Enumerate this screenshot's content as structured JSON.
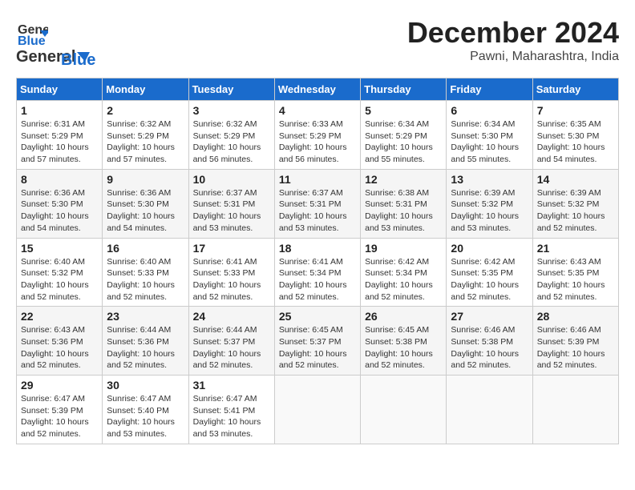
{
  "header": {
    "logo_general": "General",
    "logo_blue": "Blue",
    "main_title": "December 2024",
    "subtitle": "Pawni, Maharashtra, India"
  },
  "calendar": {
    "headers": [
      "Sunday",
      "Monday",
      "Tuesday",
      "Wednesday",
      "Thursday",
      "Friday",
      "Saturday"
    ],
    "weeks": [
      [
        {
          "day": "",
          "info": ""
        },
        {
          "day": "2",
          "info": "Sunrise: 6:32 AM\nSunset: 5:29 PM\nDaylight: 10 hours\nand 57 minutes."
        },
        {
          "day": "3",
          "info": "Sunrise: 6:32 AM\nSunset: 5:29 PM\nDaylight: 10 hours\nand 56 minutes."
        },
        {
          "day": "4",
          "info": "Sunrise: 6:33 AM\nSunset: 5:29 PM\nDaylight: 10 hours\nand 56 minutes."
        },
        {
          "day": "5",
          "info": "Sunrise: 6:34 AM\nSunset: 5:29 PM\nDaylight: 10 hours\nand 55 minutes."
        },
        {
          "day": "6",
          "info": "Sunrise: 6:34 AM\nSunset: 5:30 PM\nDaylight: 10 hours\nand 55 minutes."
        },
        {
          "day": "7",
          "info": "Sunrise: 6:35 AM\nSunset: 5:30 PM\nDaylight: 10 hours\nand 54 minutes."
        }
      ],
      [
        {
          "day": "1",
          "info": "Sunrise: 6:31 AM\nSunset: 5:29 PM\nDaylight: 10 hours\nand 57 minutes."
        },
        {
          "day": "8",
          "info": "Sunrise: 6:36 AM\nSunset: 5:30 PM\nDaylight: 10 hours\nand 54 minutes."
        },
        {
          "day": "9",
          "info": "Sunrise: 6:36 AM\nSunset: 5:30 PM\nDaylight: 10 hours\nand 54 minutes."
        },
        {
          "day": "10",
          "info": "Sunrise: 6:37 AM\nSunset: 5:31 PM\nDaylight: 10 hours\nand 53 minutes."
        },
        {
          "day": "11",
          "info": "Sunrise: 6:37 AM\nSunset: 5:31 PM\nDaylight: 10 hours\nand 53 minutes."
        },
        {
          "day": "12",
          "info": "Sunrise: 6:38 AM\nSunset: 5:31 PM\nDaylight: 10 hours\nand 53 minutes."
        },
        {
          "day": "13",
          "info": "Sunrise: 6:39 AM\nSunset: 5:32 PM\nDaylight: 10 hours\nand 53 minutes."
        },
        {
          "day": "14",
          "info": "Sunrise: 6:39 AM\nSunset: 5:32 PM\nDaylight: 10 hours\nand 52 minutes."
        }
      ],
      [
        {
          "day": "15",
          "info": "Sunrise: 6:40 AM\nSunset: 5:32 PM\nDaylight: 10 hours\nand 52 minutes."
        },
        {
          "day": "16",
          "info": "Sunrise: 6:40 AM\nSunset: 5:33 PM\nDaylight: 10 hours\nand 52 minutes."
        },
        {
          "day": "17",
          "info": "Sunrise: 6:41 AM\nSunset: 5:33 PM\nDaylight: 10 hours\nand 52 minutes."
        },
        {
          "day": "18",
          "info": "Sunrise: 6:41 AM\nSunset: 5:34 PM\nDaylight: 10 hours\nand 52 minutes."
        },
        {
          "day": "19",
          "info": "Sunrise: 6:42 AM\nSunset: 5:34 PM\nDaylight: 10 hours\nand 52 minutes."
        },
        {
          "day": "20",
          "info": "Sunrise: 6:42 AM\nSunset: 5:35 PM\nDaylight: 10 hours\nand 52 minutes."
        },
        {
          "day": "21",
          "info": "Sunrise: 6:43 AM\nSunset: 5:35 PM\nDaylight: 10 hours\nand 52 minutes."
        }
      ],
      [
        {
          "day": "22",
          "info": "Sunrise: 6:43 AM\nSunset: 5:36 PM\nDaylight: 10 hours\nand 52 minutes."
        },
        {
          "day": "23",
          "info": "Sunrise: 6:44 AM\nSunset: 5:36 PM\nDaylight: 10 hours\nand 52 minutes."
        },
        {
          "day": "24",
          "info": "Sunrise: 6:44 AM\nSunset: 5:37 PM\nDaylight: 10 hours\nand 52 minutes."
        },
        {
          "day": "25",
          "info": "Sunrise: 6:45 AM\nSunset: 5:37 PM\nDaylight: 10 hours\nand 52 minutes."
        },
        {
          "day": "26",
          "info": "Sunrise: 6:45 AM\nSunset: 5:38 PM\nDaylight: 10 hours\nand 52 minutes."
        },
        {
          "day": "27",
          "info": "Sunrise: 6:46 AM\nSunset: 5:38 PM\nDaylight: 10 hours\nand 52 minutes."
        },
        {
          "day": "28",
          "info": "Sunrise: 6:46 AM\nSunset: 5:39 PM\nDaylight: 10 hours\nand 52 minutes."
        }
      ],
      [
        {
          "day": "29",
          "info": "Sunrise: 6:47 AM\nSunset: 5:39 PM\nDaylight: 10 hours\nand 52 minutes."
        },
        {
          "day": "30",
          "info": "Sunrise: 6:47 AM\nSunset: 5:40 PM\nDaylight: 10 hours\nand 53 minutes."
        },
        {
          "day": "31",
          "info": "Sunrise: 6:47 AM\nSunset: 5:41 PM\nDaylight: 10 hours\nand 53 minutes."
        },
        {
          "day": "",
          "info": ""
        },
        {
          "day": "",
          "info": ""
        },
        {
          "day": "",
          "info": ""
        },
        {
          "day": "",
          "info": ""
        }
      ]
    ]
  }
}
